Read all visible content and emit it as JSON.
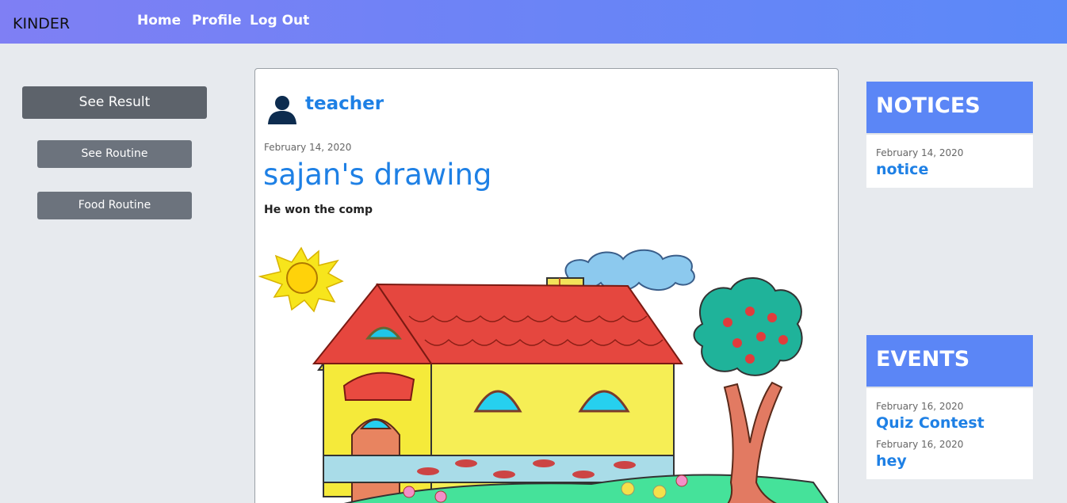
{
  "nav": {
    "brand": "KINDER",
    "home": "Home",
    "profile": "Profile",
    "logout": "Log Out"
  },
  "sidebar": {
    "see_result": "See Result",
    "see_routine": "See Routine",
    "food_routine": "Food Routine"
  },
  "post": {
    "author": "teacher",
    "date": "February 14, 2020",
    "title": "sajan's drawing",
    "body": "He won the comp"
  },
  "notices": {
    "heading": "NOTICES",
    "items": [
      {
        "date": "February 14, 2020",
        "title": "notice"
      }
    ]
  },
  "events": {
    "heading": "EVENTS",
    "items": [
      {
        "date": "February 16, 2020",
        "title": "Quiz Contest"
      },
      {
        "date": "February 16, 2020",
        "title": "hey"
      }
    ]
  },
  "colors": {
    "accent": "#1e80e5",
    "panel_header": "#5b86f6",
    "button": "#6c737d"
  }
}
